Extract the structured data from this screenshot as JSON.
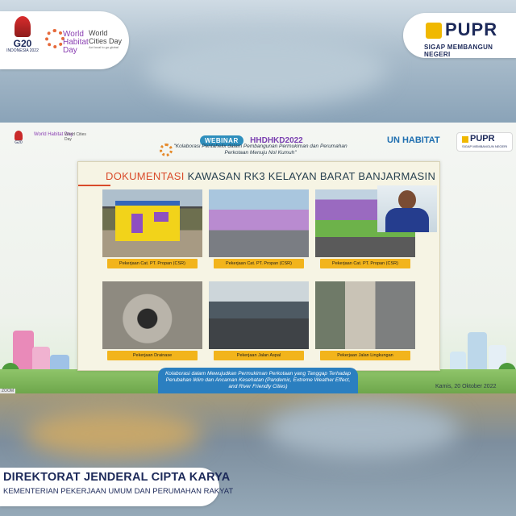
{
  "header": {
    "g20": {
      "label": "G20",
      "sub": "INDONESIA 2022"
    },
    "whd": {
      "label": "World Habitat Day"
    },
    "wcd": {
      "label": "World Cities Day",
      "tagline": "Act local to go global"
    },
    "pupr": {
      "word": "PUPR",
      "tagline": "SIGAP MEMBANGUN NEGERI"
    }
  },
  "webinar": {
    "badge": "WEBINAR",
    "brand": "HHDHKD2022",
    "theme": "\"Kolaborasi Pentahelix dalam Pembangunan Permukiman dan Perumahan Perkotaan Menuju Nol Kumuh\"",
    "unhabitat": "UN HABITAT",
    "mini_pupr": {
      "word": "PUPR",
      "tagline": "SIGAP MEMBANGUN NEGERI"
    }
  },
  "slide": {
    "title_highlight": "DOKUMENTASI",
    "title_rest": " KAWASAN RK3 KELAYAN BARAT BANJARMASIN",
    "photos": [
      {
        "caption": "Pekerjaan Cat. PT. Propan (CSR)"
      },
      {
        "caption": "Pekerjaan Cat. PT. Propan (CSR)"
      },
      {
        "caption": "Pekerjaan Cat. PT. Propan (CSR)"
      },
      {
        "caption": "Pekerjaan Drainase"
      },
      {
        "caption": "Pekerjaan Jalan Aspal"
      },
      {
        "caption": "Pekerjaan Jalan Lingkungan"
      }
    ]
  },
  "footer_banner": {
    "text": "Kolaborasi dalam Mewujudkan Permukiman Perkotaan yang Tanggap Terhadap Perubahan Iklim dan Ancaman Kesehatan (Pandemic, Extreme Weather Effect, and River Friendly Cities)"
  },
  "date": "Kamis, 20 Oktober 2022",
  "zoom_tag": "ZOOM",
  "lower_third": {
    "title": "DIREKTORAT JENDERAL CIPTA KARYA",
    "subtitle": "KEMENTERIAN PEKERJAAN UMUM DAN PERUMAHAN RAKYAT"
  },
  "colors": {
    "navy": "#1d2a5a",
    "pupr_yellow": "#f0b800",
    "caption_yellow": "#f2b41c",
    "accent_red": "#d94b2b",
    "banner_blue": "#2b7fc0",
    "unhabitat_blue": "#1f6fb0"
  }
}
